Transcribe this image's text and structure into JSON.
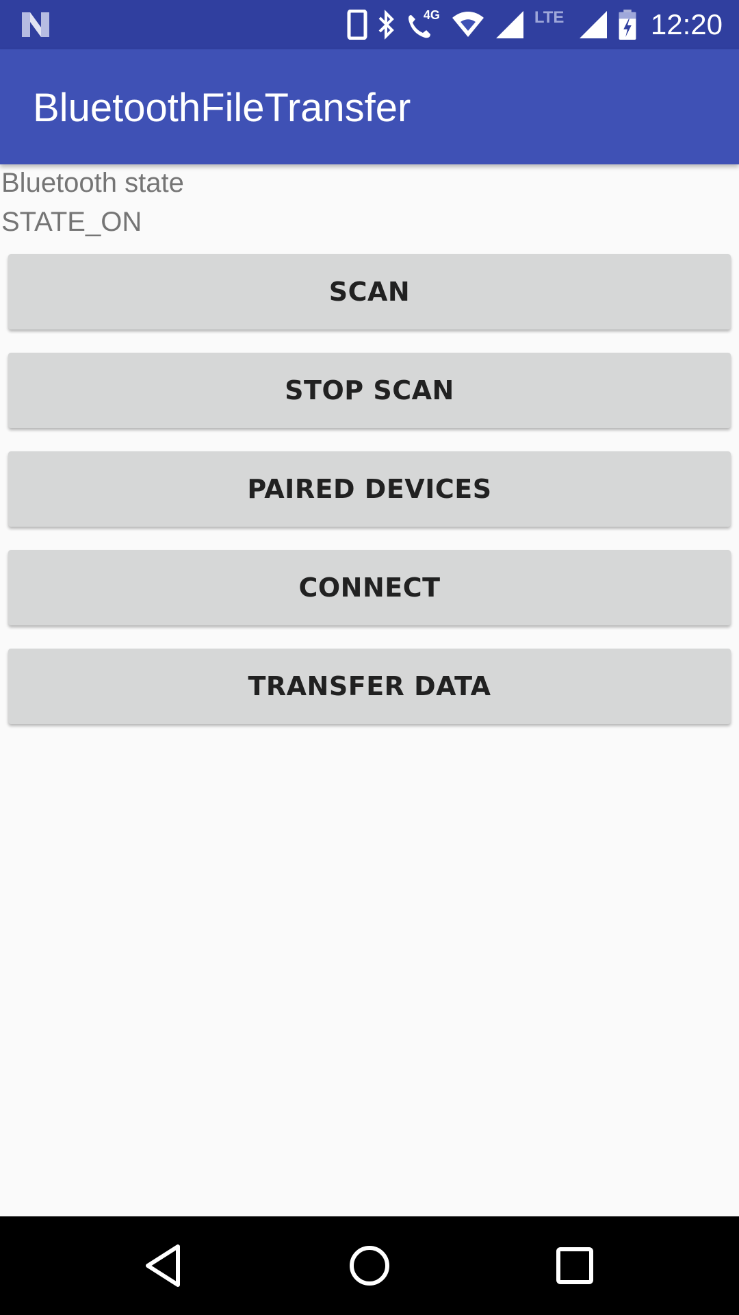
{
  "status_bar": {
    "time": "12:20",
    "network_label": "4G",
    "lte_label": "LTE",
    "icons": [
      "n-logo-icon",
      "phone-icon",
      "bluetooth-icon",
      "wifi-call-icon",
      "wifi-icon",
      "signal-icon",
      "lte-signal-icon",
      "battery-charging-icon"
    ]
  },
  "app_bar": {
    "title": "BluetoothFileTransfer"
  },
  "bluetooth": {
    "state_label": "Bluetooth state",
    "state_value": "STATE_ON"
  },
  "buttons": {
    "scan": "SCAN",
    "stop_scan": "STOP SCAN",
    "paired_devices": "PAIRED DEVICES",
    "connect": "CONNECT",
    "transfer_data": "TRANSFER DATA"
  },
  "nav_bar": {
    "icons": [
      "back-icon",
      "home-icon",
      "recents-icon"
    ]
  },
  "colors": {
    "status_bar": "#303f9f",
    "app_bar": "#3f51b5",
    "background": "#fafafa",
    "button": "#d6d7d7",
    "button_text": "#212121",
    "secondary_text": "#757575"
  }
}
